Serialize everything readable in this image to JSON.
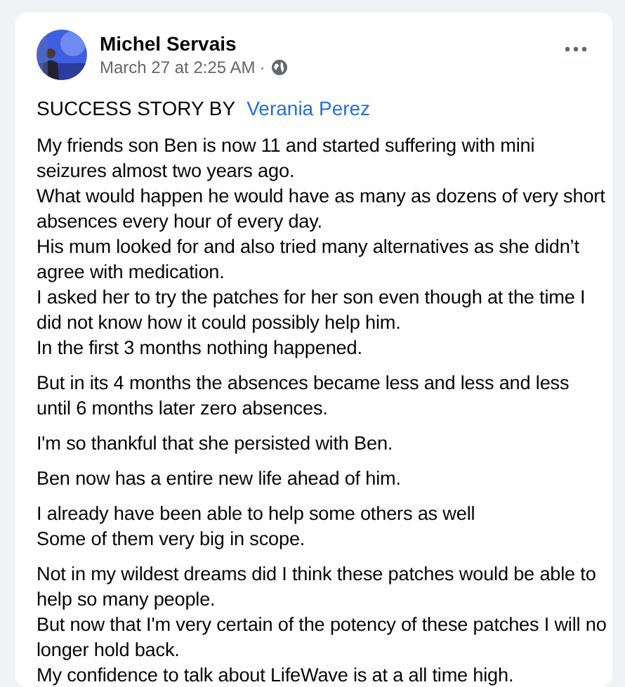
{
  "post": {
    "author": "Michel Servais",
    "timestamp": "March 27 at 2:25 AM",
    "separator": "·",
    "headline": {
      "text": "SUCCESS STORY BY",
      "link": "Verania Perez"
    },
    "paragraphs": [
      [
        "My friends son Ben is now 11 and started suffering with mini seizures almost two years ago.",
        "What would happen he would have as many as dozens of very short absences every hour of every day.",
        "His mum looked for and also tried many alternatives as she didn’t agree with medication.",
        "I asked her to try the patches for her son even though at the time I did not know how it could possibly help him.",
        "In the first 3 months nothing happened."
      ],
      [
        "But in its 4 months the absences became less and less and less until 6 months later zero absences."
      ],
      [
        "I'm so thankful that she persisted with Ben."
      ],
      [
        "Ben now has a entire new life ahead of him."
      ],
      [
        "I already have been able to help some others as well",
        "Some of them very big in scope."
      ],
      [
        "Not in my wildest dreams did I think these patches would be able to help so many people.",
        "But now that I'm very certain of the potency of these patches I will no longer hold back.",
        "My confidence to talk about LifeWave is at a all time high."
      ]
    ]
  }
}
